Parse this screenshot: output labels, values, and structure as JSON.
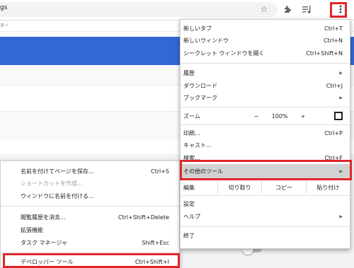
{
  "toolbar": {
    "omnibox_fragment": "gs",
    "icons": [
      "star-icon",
      "extensions-icon",
      "reading-list-icon",
      "more-menu-icon"
    ]
  },
  "bookmark_bar": {
    "fragment": "ター"
  },
  "main_menu": {
    "new_tab": {
      "label": "新しいタブ",
      "shortcut": "Ctrl+T"
    },
    "new_window": {
      "label": "新しいウィンドウ",
      "shortcut": "Ctrl+N"
    },
    "incognito": {
      "label": "シークレット ウィンドウを開く",
      "shortcut": "Ctrl+Shift+N"
    },
    "history": {
      "label": "履歴"
    },
    "downloads": {
      "label": "ダウンロード",
      "shortcut": "Ctrl+J"
    },
    "bookmarks": {
      "label": "ブックマーク"
    },
    "zoom": {
      "label": "ズーム",
      "minus": "−",
      "value": "100%",
      "plus": "+"
    },
    "print": {
      "label": "印刷...",
      "shortcut": "Ctrl+P"
    },
    "cast": {
      "label": "キャスト..."
    },
    "find": {
      "label": "検索...",
      "shortcut": "Ctrl+F"
    },
    "more_tools": {
      "label": "その他のツール"
    },
    "edit": {
      "label": "編集",
      "cut": "切り取り",
      "copy": "コピー",
      "paste": "貼り付け"
    },
    "settings": {
      "label": "設定"
    },
    "help": {
      "label": "ヘルプ"
    },
    "exit": {
      "label": "終了"
    }
  },
  "sub_menu": {
    "save_page": {
      "label": "名前を付けてページを保存...",
      "shortcut": "Ctrl+S"
    },
    "create_shortcut": {
      "label": "ショートカットを作成..."
    },
    "name_window": {
      "label": "ウィンドウに名前を付ける..."
    },
    "clear_data": {
      "label": "閲覧履歴を消去...",
      "shortcut": "Ctrl+Shift+Delete"
    },
    "extensions": {
      "label": "拡張機能"
    },
    "task_manager": {
      "label": "タスク マネージャ",
      "shortcut": "Shift+Esc"
    },
    "dev_tools": {
      "label": "デベロッパー ツール",
      "shortcut": "Ctrl+Shift+I"
    }
  },
  "colors": {
    "accent_blue": "#3367d6",
    "highlight_red": "#e0262b",
    "hover_gray": "#d2d2d2"
  }
}
